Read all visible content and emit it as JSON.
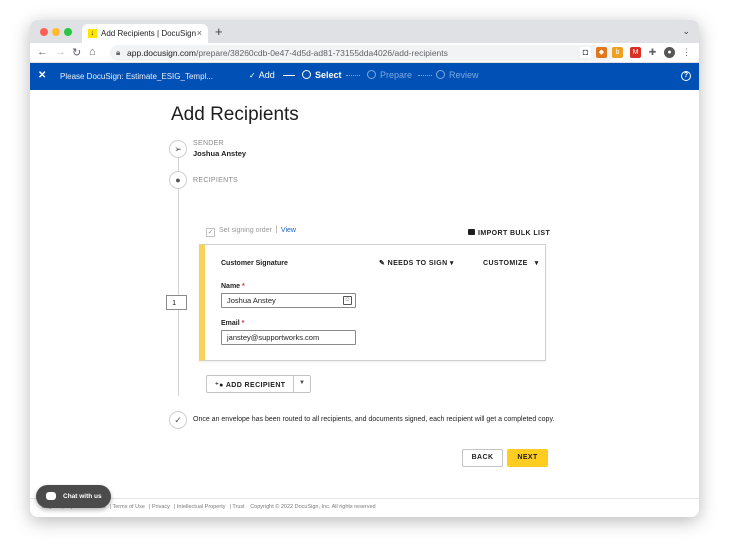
{
  "browser": {
    "tab_title": "Add Recipients | DocuSign",
    "url_domain": "app.docusign.com",
    "url_path": "/prepare/38260cdb-0e47-4d5d-ad81-73155dda4026/add-recipients",
    "new_tab": "+",
    "tab_close": "×",
    "tab_menu": "⌄"
  },
  "header": {
    "envelope_name": "Please DocuSign: Estimate_ESIG_Templ...",
    "steps": [
      {
        "label": "Add",
        "state": "done"
      },
      {
        "label": "Select",
        "state": "active"
      },
      {
        "label": "Prepare",
        "state": "future"
      },
      {
        "label": "Review",
        "state": "future"
      }
    ],
    "help": "?"
  },
  "page": {
    "title": "Add Recipients",
    "sender_label": "SENDER",
    "sender_name": "Joshua Anstey",
    "recipients_label": "RECIPIENTS",
    "set_signing_order": "Set signing order",
    "view_link": "View",
    "import_bulk": "IMPORT BULK LIST",
    "recipient": {
      "order": "1",
      "role": "Customer Signature",
      "action": "NEEDS TO SIGN",
      "customize": "CUSTOMIZE",
      "name_label": "Name",
      "name_value": "Joshua Anstey",
      "email_label": "Email",
      "email_value": "janstey@supportworks.com",
      "required_mark": "*"
    },
    "add_recipient": "ADD RECIPIENT",
    "completion_note": "Once an envelope has been routed to all recipients, and documents signed, each recipient will get a completed copy.",
    "back": "BACK",
    "next": "NEXT"
  },
  "footer": {
    "items": [
      "English (US)",
      "Contact Us",
      "Terms of Use",
      "Privacy",
      "Intellectual Property",
      "Trust",
      "Copyright © 2022 DocuSign, Inc. All rights reserved"
    ]
  },
  "chat": {
    "label": "Chat with us"
  },
  "colors": {
    "header_blue": "#0050b5",
    "accent_yellow": "#ffcc22",
    "card_stripe": "#f7d35d",
    "link_blue": "#1d61c3"
  }
}
